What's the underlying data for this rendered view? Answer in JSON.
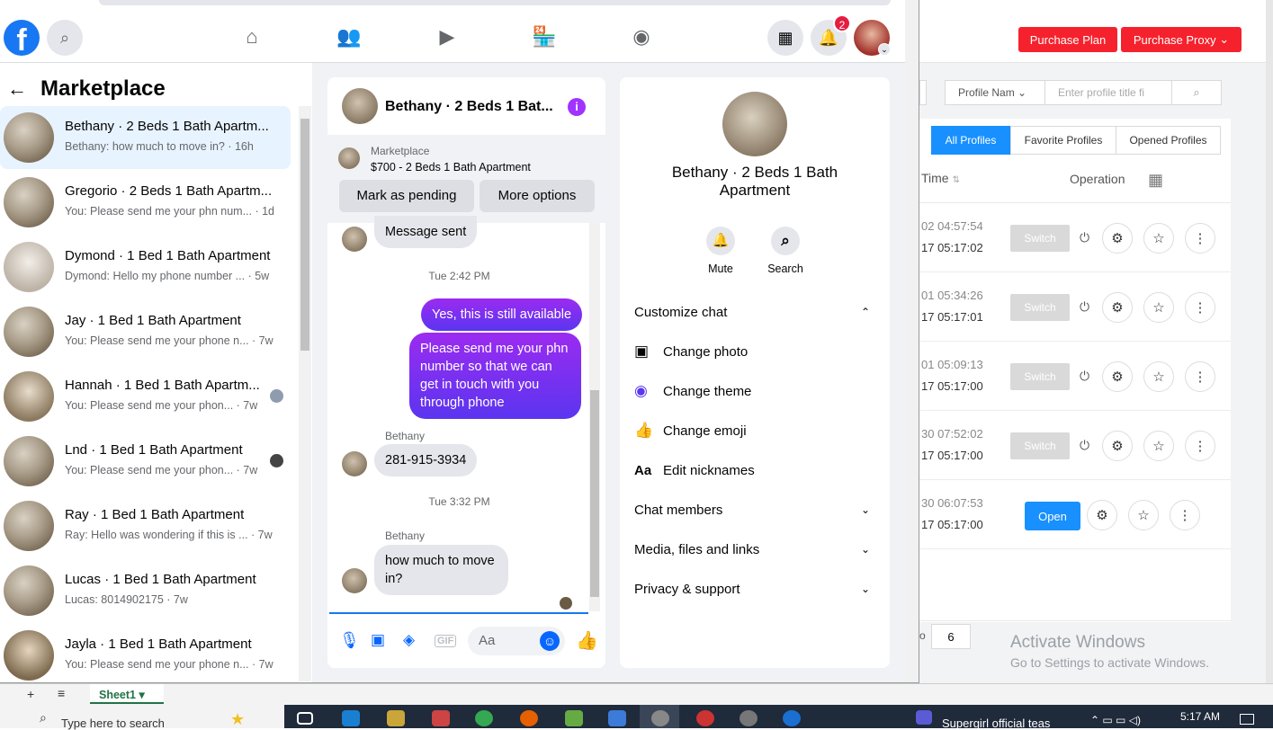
{
  "fb": {
    "page_title": "Marketplace",
    "notif_count": "2",
    "conversations": [
      {
        "name": "Bethany · 2 Beds 1 Bath Apartm...",
        "preview": "Bethany: how much to move in? · 16h"
      },
      {
        "name": "Gregorio · 2 Beds 1 Bath Apartm...",
        "preview": "You: Please send me your phn num...  · 1d"
      },
      {
        "name": "Dymond · 1 Bed 1 Bath Apartment",
        "preview": "Dymond: Hello my phone number ... · 5w"
      },
      {
        "name": "Jay · 1 Bed 1 Bath Apartment",
        "preview": "You: Please send me your phone n... · 7w"
      },
      {
        "name": "Hannah · 1 Bed 1 Bath Apartm...",
        "preview": "You: Please send me your phon... · 7w"
      },
      {
        "name": "Lnd · 1 Bed 1 Bath Apartment",
        "preview": "You: Please send me your phon... · 7w"
      },
      {
        "name": "Ray · 1 Bed 1 Bath Apartment",
        "preview": "Ray: Hello was wondering if this is ... · 7w"
      },
      {
        "name": "Lucas · 1 Bed 1 Bath Apartment",
        "preview": "Lucas: 8014902175 · 7w"
      },
      {
        "name": "Jayla · 1 Bed 1 Bath Apartment",
        "preview": "You: Please send me your phone n... · 7w"
      }
    ],
    "chat": {
      "title": "Bethany · 2 Beds 1 Bat...",
      "listing_source": "Marketplace",
      "listing_title": "$700 - 2 Beds 1 Bath Apartment",
      "mark_pending": "Mark as pending",
      "more_options": "More options",
      "msg_sent": "Message sent",
      "time1": "Tue 2:42 PM",
      "out1": "Yes, this is still available",
      "out2": "Please send me your phn number so that we can get in touch with you through phone",
      "sender1": "Bethany",
      "in1": "281-915-3934",
      "time2": "Tue 3:32 PM",
      "sender2": "Bethany",
      "in2": "how much to move in?",
      "composer_placeholder": "Aa"
    },
    "info": {
      "name": "Bethany · 2 Beds 1 Bath Apartment",
      "mute": "Mute",
      "search": "Search",
      "customize": "Customize chat",
      "change_photo": "Change photo",
      "change_theme": "Change theme",
      "change_emoji": "Change emoji",
      "edit_nicknames": "Edit nicknames",
      "chat_members": "Chat members",
      "media": "Media, files and links",
      "privacy": "Privacy & support"
    }
  },
  "bg": {
    "purchase_plan": "Purchase Plan",
    "purchase_proxy": "Purchase Proxy",
    "profile_select": "Profile Nam",
    "profile_placeholder": "Enter profile title fi",
    "tab_all": "All Profiles",
    "tab_fav": "Favorite Profiles",
    "tab_opened": "Opened Profiles",
    "col_time": "Time",
    "col_operation": "Operation",
    "rows": [
      {
        "t1": "02 04:57:54",
        "t2": "17 05:17:02",
        "btn": "Switch"
      },
      {
        "t1": "01 05:34:26",
        "t2": "17 05:17:01",
        "btn": "Switch"
      },
      {
        "t1": "01 05:09:13",
        "t2": "17 05:17:00",
        "btn": "Switch"
      },
      {
        "t1": "30 07:52:02",
        "t2": "17 05:17:00",
        "btn": "Switch"
      },
      {
        "t1": "30 06:07:53",
        "t2": "17 05:17:00",
        "btn": "Open"
      }
    ],
    "page_prefix": "o",
    "page_size": "6",
    "activate_title": "Activate Windows",
    "activate_sub": "Go to Settings to activate Windows."
  },
  "excel": {
    "sheet": "Sheet1"
  },
  "taskbar": {
    "search": "Type here to search",
    "media": "Supergirl official teas",
    "time": "5:17 AM"
  }
}
